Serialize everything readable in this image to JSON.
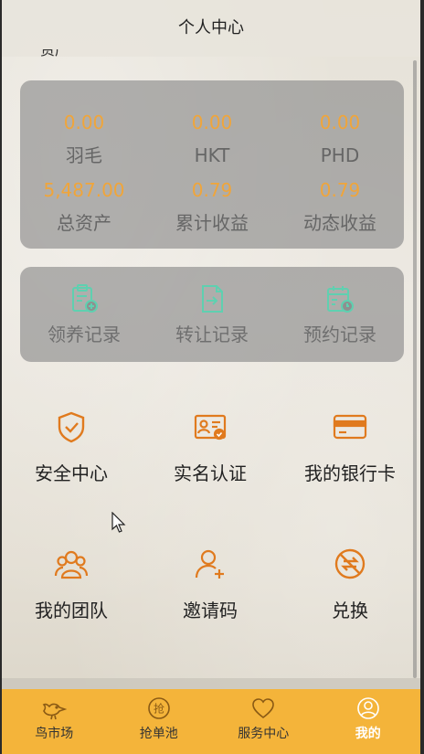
{
  "header": {
    "title": "个人中心"
  },
  "assets": [
    {
      "value": "0.00",
      "label": "羽毛"
    },
    {
      "value": "0.00",
      "label": "HKT"
    },
    {
      "value": "0.00",
      "label": "PHD"
    },
    {
      "value": "5,487.00",
      "label": "总资产"
    },
    {
      "value": "0.79",
      "label": "累计收益"
    },
    {
      "value": "0.79",
      "label": "动态收益"
    }
  ],
  "records": [
    {
      "label": "领养记录",
      "icon": "clipboard-add-icon"
    },
    {
      "label": "转让记录",
      "icon": "transfer-doc-icon"
    },
    {
      "label": "预约记录",
      "icon": "calendar-clock-icon"
    }
  ],
  "menu": [
    {
      "label": "安全中心",
      "icon": "shield-check-icon"
    },
    {
      "label": "实名认证",
      "icon": "id-card-icon"
    },
    {
      "label": "我的银行卡",
      "icon": "bank-card-icon"
    },
    {
      "label": "我的团队",
      "icon": "team-icon"
    },
    {
      "label": "邀请码",
      "icon": "user-add-icon"
    },
    {
      "label": "兑换",
      "icon": "exchange-icon"
    }
  ],
  "tabs": [
    {
      "label": "鸟市场",
      "icon": "bird-icon",
      "active": false
    },
    {
      "label": "抢单池",
      "icon": "grab-order-icon",
      "active": false
    },
    {
      "label": "服务中心",
      "icon": "heart-icon",
      "active": false
    },
    {
      "label": "我的",
      "icon": "user-icon",
      "active": true
    }
  ],
  "colors": {
    "accent": "#f0a53a",
    "icon_orange": "#e07a1e",
    "icon_teal": "#5fd0b0",
    "tabbar": "#f4b43a"
  }
}
